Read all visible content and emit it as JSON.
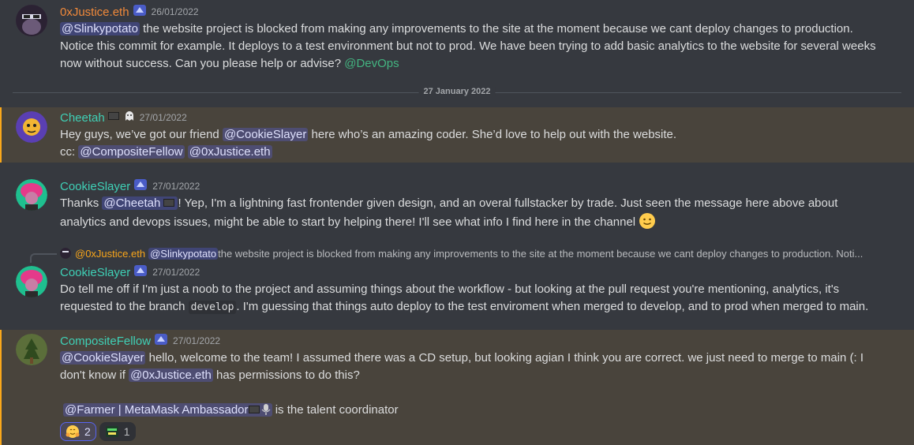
{
  "colors": {
    "orange": "#e67e22",
    "teal": "#1abc9c",
    "cyan": "#43d9c0",
    "mention_bg": "#414675"
  },
  "messages": [
    {
      "username": "0xJustice.eth",
      "timestamp": "26/01/2022",
      "mention1": "@Slinkypotato",
      "text1": " the website project is blocked from making any improvements to the site at the moment because we cant deploy changes to production. Notice this commit for example. It deploys to a test environment but not to prod. We have been trying to add basic analytics to the website for several weeks now without success. Can you please help or advise? ",
      "channel_mention": "@DevOps"
    },
    {
      "username": "Cheetah",
      "timestamp": "27/01/2022",
      "text1": "Hey guys, we’ve got our friend ",
      "mention1": "@CookieSlayer",
      "text2": " here who’s an amazing coder. She’d love to help out with the website.",
      "cc": "cc: ",
      "mention2": "@CompositeFellow",
      "mention3": "@0xJustice.eth"
    },
    {
      "username": "CookieSlayer",
      "timestamp": "27/01/2022",
      "text1": "Thanks ",
      "mention1": "@Cheetah",
      "text2": "! Yep, I'm a lightning fast frontender given design, and an overal fullstacker by trade. Just seen the message here above about analytics and devops issues, might be able to start by helping there! I'll see what info I find here in the channel "
    },
    {
      "reply_user": "@0xJustice.eth",
      "reply_mention": "@Slinkypotato",
      "reply_text": " the website project is blocked from making any improvements to the site at the moment because we cant deploy changes to production. Noti...",
      "username": "CookieSlayer",
      "timestamp": "27/01/2022",
      "text1": "Do tell me off if I'm just a noob to the project and assuming things about the workflow -  but looking at the pull request you're mentioning, analytics, it's requested to the branch ",
      "code": "develop",
      "text2": ". I'm guessing that things auto deploy to the test enviroment when merged to develop, and to prod when merged to main."
    },
    {
      "username": "CompositeFellow",
      "timestamp": "27/01/2022",
      "mention1": "@CookieSlayer",
      "text1": " hello, welcome to the team!  I assumed there was a CD setup, but looking agian I think you are correct. we just need to merge to main (: I don't know if ",
      "mention2": "@0xJustice.eth",
      "text2": " has permissions to do this?",
      "mention3": "@Farmer | MetaMask Ambassador",
      "text3": " is the talent coordinator",
      "reactions": [
        {
          "emoji": "hugging-face-emoji",
          "count": "2",
          "active": true
        },
        {
          "emoji": "thank-you-sticker-emoji",
          "count": "1",
          "active": false
        }
      ]
    }
  ],
  "divider": "27 January 2022"
}
